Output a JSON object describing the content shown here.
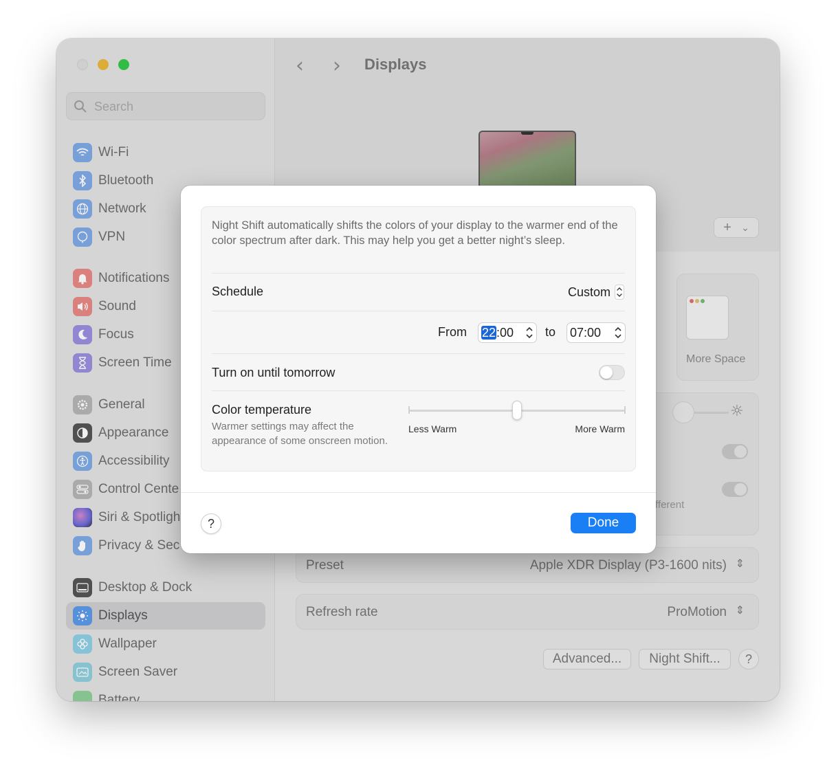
{
  "window": {
    "title": "Displays",
    "search_placeholder": "Search"
  },
  "sidebar": {
    "items": [
      {
        "label": "Wi-Fi",
        "icon": "wifi-icon",
        "color": "#4a8ff0"
      },
      {
        "label": "Bluetooth",
        "icon": "bluetooth-icon",
        "color": "#4a8ff0"
      },
      {
        "label": "Network",
        "icon": "globe-icon",
        "color": "#4a8ff0"
      },
      {
        "label": "VPN",
        "icon": "vpn-globe-icon",
        "color": "#4a8ff0"
      },
      {
        "label": "Notifications",
        "icon": "bell-icon",
        "color": "#e2554c"
      },
      {
        "label": "Sound",
        "icon": "speaker-icon",
        "color": "#e2554c"
      },
      {
        "label": "Focus",
        "icon": "moon-icon",
        "color": "#6a5ad8"
      },
      {
        "label": "Screen Time",
        "icon": "hourglass-icon",
        "color": "#6a5ad8"
      },
      {
        "label": "General",
        "icon": "gear-icon",
        "color": "#9a9a9a"
      },
      {
        "label": "Appearance",
        "icon": "appearance-icon",
        "color": "#2a2a2a"
      },
      {
        "label": "Accessibility",
        "icon": "accessibility-icon",
        "color": "#3a86e8"
      },
      {
        "label": "Control Cente",
        "icon": "control-center-icon",
        "color": "#9a9a9a"
      },
      {
        "label": "Siri & Spotligh",
        "icon": "siri-icon",
        "color": "#7a4ad0"
      },
      {
        "label": "Privacy & Sec",
        "icon": "hand-icon",
        "color": "#3a86e8"
      },
      {
        "label": "Desktop & Dock",
        "icon": "dock-icon",
        "color": "#2a2a2a"
      },
      {
        "label": "Displays",
        "icon": "sun-icon",
        "color": "#3a86e8",
        "selected": true
      },
      {
        "label": "Wallpaper",
        "icon": "flower-icon",
        "color": "#3fb6d8"
      },
      {
        "label": "Screen Saver",
        "icon": "screen-saver-icon",
        "color": "#4ab8c8"
      },
      {
        "label": "Battery",
        "icon": "battery-icon",
        "color": "#4cb35a"
      }
    ]
  },
  "background": {
    "more_space": "More Space",
    "partial_text": "fferent",
    "preset_label": "Preset",
    "preset_value": "Apple XDR Display (P3-1600 nits)",
    "refresh_label": "Refresh rate",
    "refresh_value": "ProMotion",
    "advanced_button": "Advanced...",
    "night_shift_button": "Night Shift...",
    "help_button": "?",
    "add_button": "+"
  },
  "dialog": {
    "description": "Night Shift automatically shifts the colors of your display to the warmer end of the color spectrum after dark. This may help you get a better night’s sleep.",
    "schedule_label": "Schedule",
    "schedule_value": "Custom",
    "from_label": "From",
    "from_hour": "22",
    "from_rest": ":00",
    "to_label": "to",
    "to_value": "07:00",
    "turn_on_label": "Turn on until tomorrow",
    "turn_on_state": false,
    "color_temp_label": "Color temperature",
    "color_temp_sub": "Warmer settings may affect the appearance of some onscreen motion.",
    "less_warm": "Less Warm",
    "more_warm": "More Warm",
    "slider_value": 0.5,
    "help": "?",
    "done": "Done",
    "accent": "#1a7ef5"
  }
}
